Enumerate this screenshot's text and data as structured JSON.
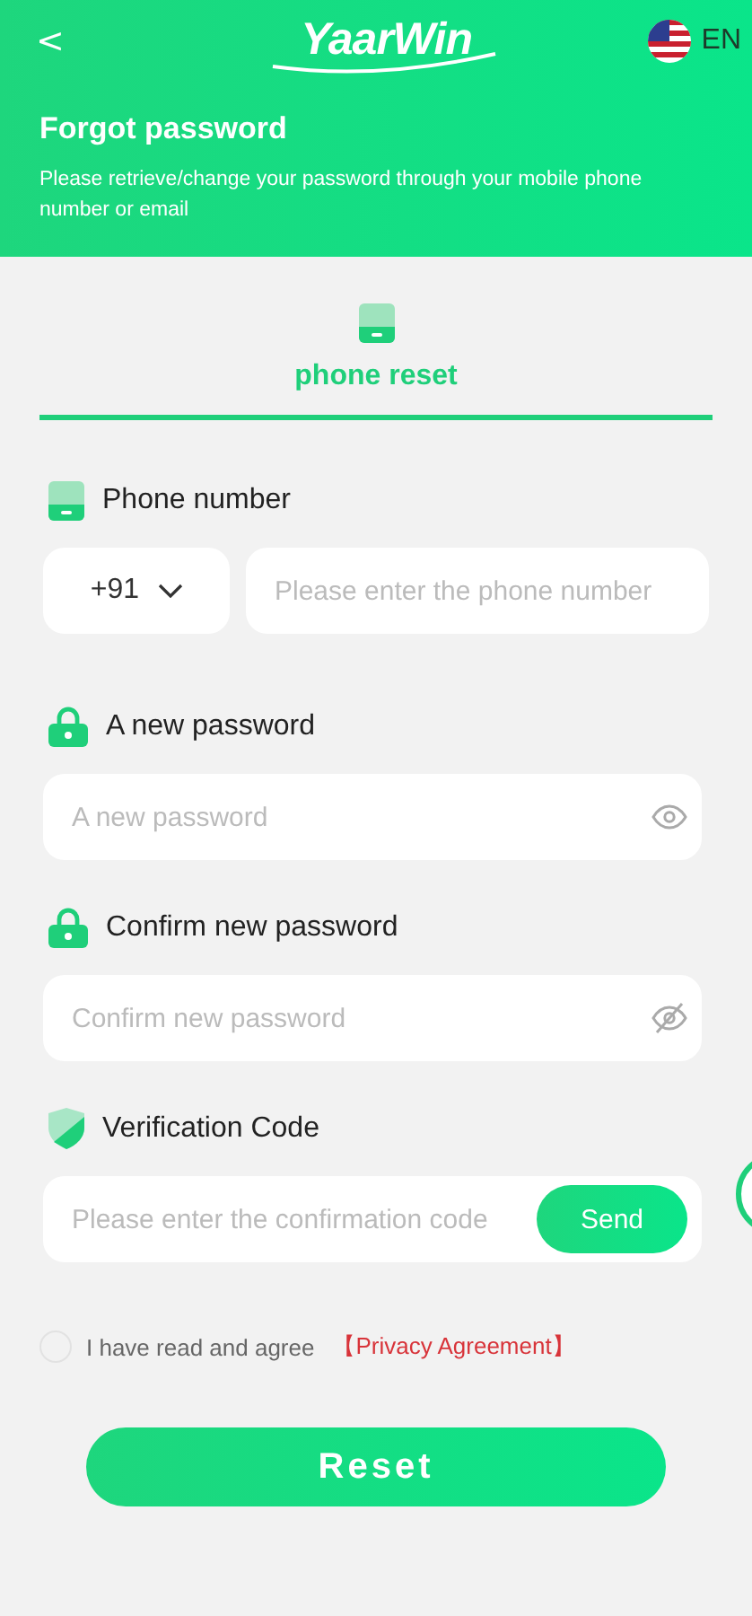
{
  "header": {
    "back": "<",
    "logo": "YaarWin",
    "language": "EN",
    "title": "Forgot password",
    "description": "Please retrieve/change your password through your mobile phone number or email"
  },
  "tabs": [
    {
      "label": "phone reset",
      "selected": true
    }
  ],
  "fields": [
    {
      "kind": "phone",
      "label": "Phone number",
      "country_code": "+91",
      "placeholder": "Please enter the phone number"
    },
    {
      "kind": "password",
      "label": "A new password",
      "placeholder": "A new password",
      "visible": true
    },
    {
      "kind": "password",
      "label": "Confirm new password",
      "placeholder": "Confirm new password",
      "visible": false
    },
    {
      "kind": "code",
      "label": "Verification Code",
      "placeholder": "Please enter the confirmation code",
      "button": "Send"
    }
  ],
  "agreement": {
    "checked": false,
    "text": "I have read and agree",
    "link": "【Privacy Agreement】"
  },
  "submit": "Reset"
}
